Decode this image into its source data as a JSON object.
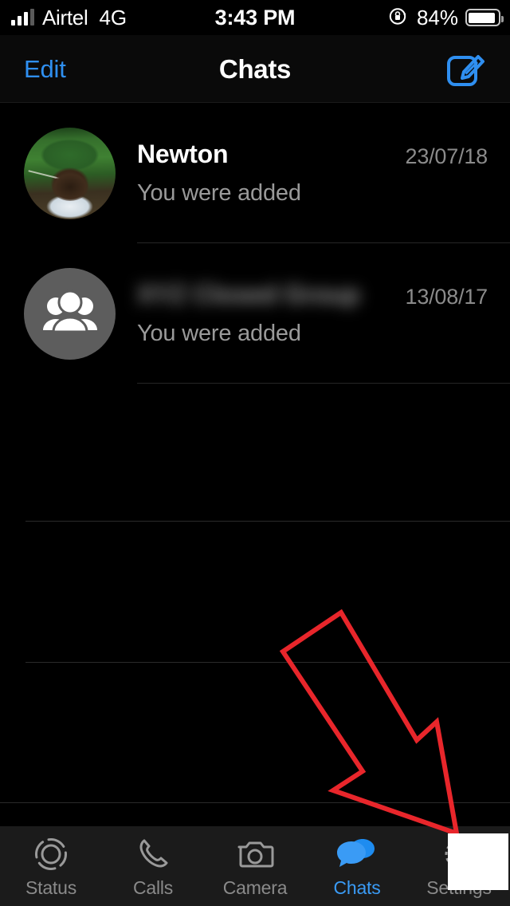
{
  "status_bar": {
    "signal_icon": "signal-bars-icon",
    "carrier": "Airtel",
    "network_mode": "4G",
    "time": "3:43 PM",
    "rotation_lock_icon": "rotation-lock-icon",
    "battery_percent": "84%",
    "battery_icon": "battery-icon"
  },
  "nav_bar": {
    "edit_label": "Edit",
    "title": "Chats",
    "compose_icon": "compose-icon"
  },
  "chats": [
    {
      "name": "Newton",
      "name_redacted": false,
      "message": "You were added",
      "date": "23/07/18",
      "avatar_type": "photo"
    },
    {
      "name": "XYZ Closed Group",
      "name_redacted": true,
      "message": "You were added",
      "date": "13/08/17",
      "avatar_type": "group-icon"
    }
  ],
  "tabs": [
    {
      "label": "Status",
      "icon": "status-ring-icon",
      "active": false
    },
    {
      "label": "Calls",
      "icon": "phone-icon",
      "active": false
    },
    {
      "label": "Camera",
      "icon": "camera-icon",
      "active": false
    },
    {
      "label": "Chats",
      "icon": "chat-bubbles-icon",
      "active": true
    },
    {
      "label": "Settings",
      "icon": "gear-icon",
      "active": false
    }
  ],
  "annotations": {
    "arrow_icon": "red-arrow-annotation",
    "arrow_color": "#e8262b",
    "white_box_icon": "white-redaction-box"
  },
  "colors": {
    "background": "#000000",
    "tab_bar": "#1b1b1b",
    "accent_blue": "#2f8ff0",
    "active_tab_blue": "#3a9bf5",
    "secondary_text": "#9a9a9a",
    "date_text": "#8b8b8b",
    "separator": "#262626",
    "annotation_red": "#e8262b"
  }
}
